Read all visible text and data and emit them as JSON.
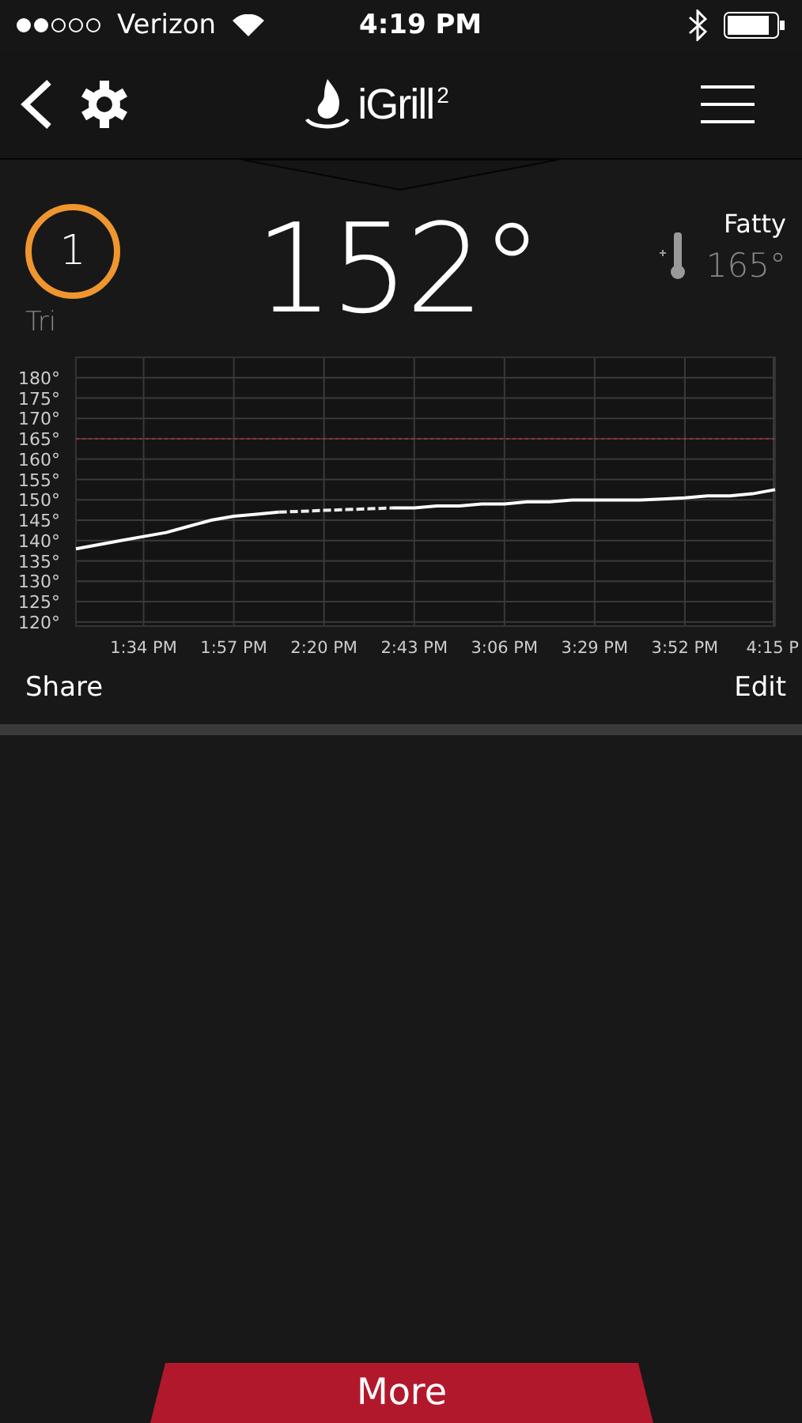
{
  "status_bar": {
    "carrier": "Verizon",
    "time": "4:19 PM"
  },
  "nav": {
    "logo_text": "iGrill",
    "logo_sup": "2"
  },
  "probe": {
    "number": "1",
    "label": "Tri",
    "temperature": "152°",
    "preset_name": "Fatty",
    "target": "165°"
  },
  "chart": {
    "chart_data": {
      "type": "line",
      "categories": [
        null,
        null,
        null,
        "1:34 PM",
        null,
        null,
        null,
        "1:57 PM",
        null,
        null,
        null,
        "2:20 PM",
        null,
        null,
        null,
        "2:43 PM",
        null,
        null,
        null,
        "3:06 PM",
        null,
        null,
        null,
        "3:29 PM",
        null,
        null,
        null,
        "3:52 PM",
        null,
        null,
        null,
        "4:15 P"
      ],
      "series": [
        {
          "color": "#ffffff",
          "line_style": "solid",
          "values": [
            138,
            139,
            140,
            141,
            142,
            143.5,
            145,
            146,
            146.5,
            147,
            null,
            null,
            null,
            null,
            148,
            148,
            148.5,
            148.5,
            149,
            149,
            149.5,
            149.5,
            150,
            150,
            150,
            150,
            150.2,
            150.5,
            151,
            151,
            151.5,
            152.5
          ]
        },
        {
          "color": "#eeeeee",
          "line_style": "dashed",
          "values": [
            null,
            null,
            null,
            null,
            null,
            null,
            null,
            null,
            null,
            147,
            147.2,
            147.4,
            147.6,
            147.8,
            148,
            null,
            null,
            null,
            null,
            null,
            null,
            null,
            null,
            null,
            null,
            null,
            null,
            null,
            null,
            null,
            null,
            null
          ]
        }
      ],
      "ylim": [
        119,
        185
      ],
      "yticks": [
        {
          "value": 120,
          "label": "120°"
        },
        {
          "value": 125,
          "label": "125°"
        },
        {
          "value": 130,
          "label": "130°"
        },
        {
          "value": 135,
          "label": "135°"
        },
        {
          "value": 140,
          "label": "140°"
        },
        {
          "value": 145,
          "label": "145°"
        },
        {
          "value": 150,
          "label": "150°"
        },
        {
          "value": 155,
          "label": "155°"
        },
        {
          "value": 160,
          "label": "160°"
        },
        {
          "value": 165,
          "label": "165°"
        },
        {
          "value": 170,
          "label": "170°"
        },
        {
          "value": 175,
          "label": "175°"
        },
        {
          "value": 180,
          "label": "180°"
        }
      ],
      "grid": true,
      "ref_lines": [
        {
          "axis": "y",
          "value": 165,
          "color": "#a03030"
        }
      ]
    }
  },
  "actions": {
    "share": "Share",
    "edit": "Edit"
  },
  "more_button": "More"
}
